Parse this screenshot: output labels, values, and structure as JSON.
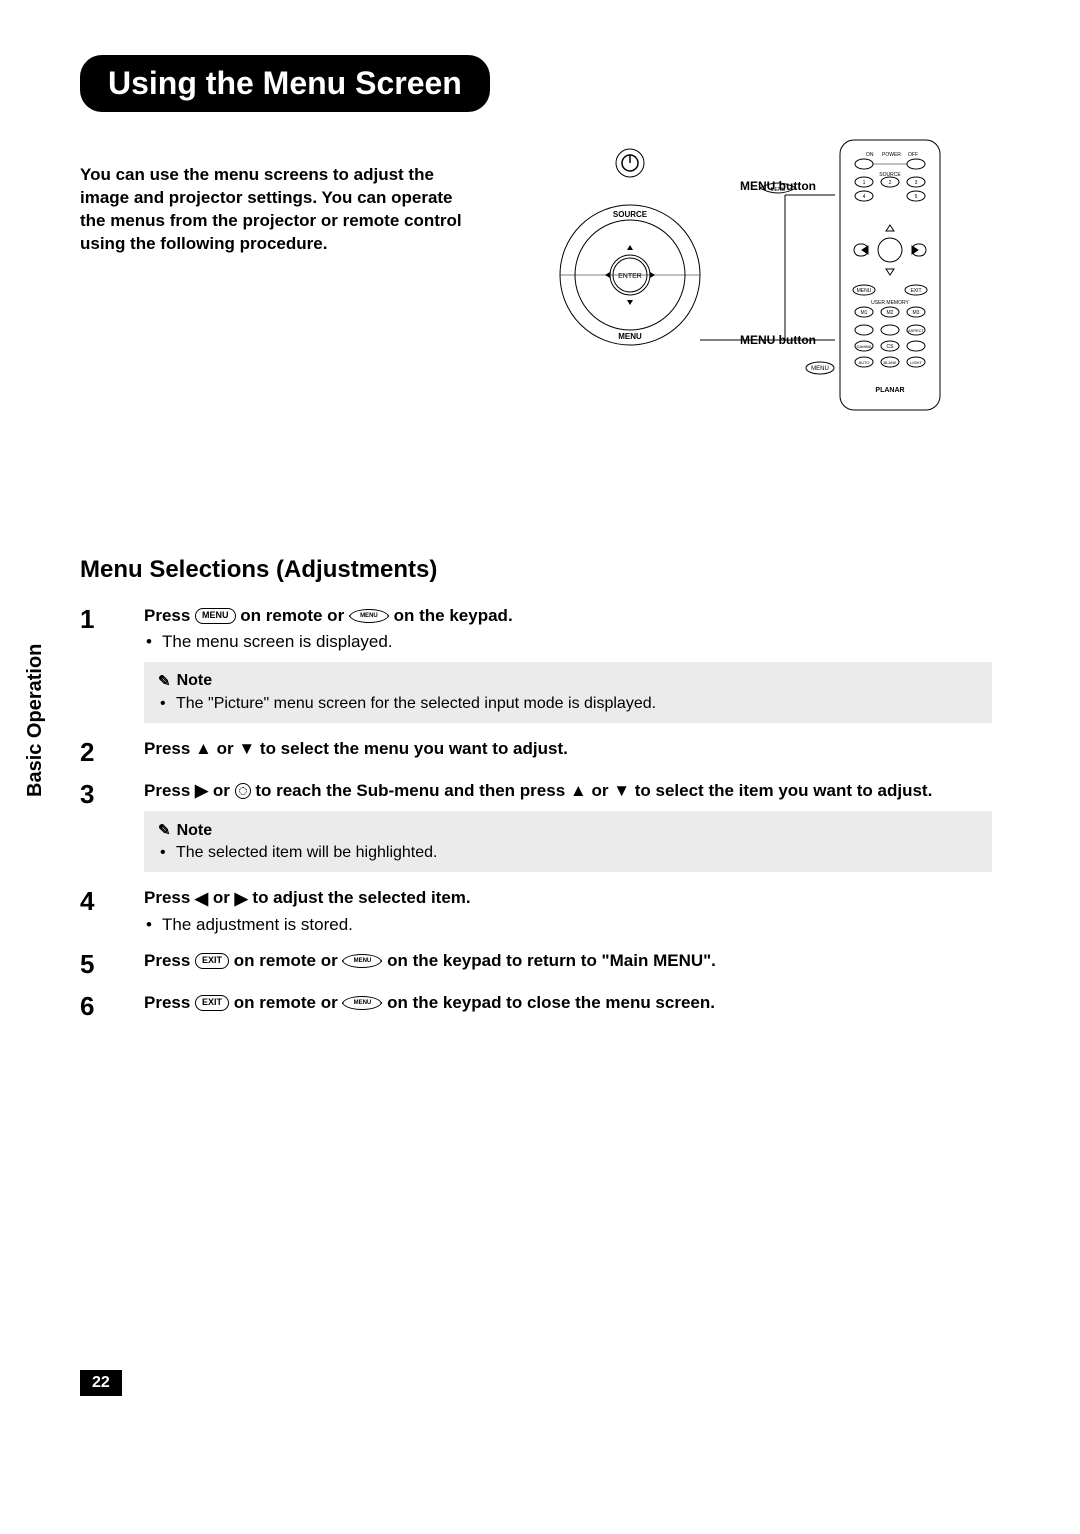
{
  "title": "Using the Menu Screen",
  "intro": "You can use the menu screens to adjust the image and projector settings. You can operate the menus from the projector or remote control using the following procedure.",
  "section_heading": "Menu Selections (Adjustments)",
  "sidebar": "Basic Operation",
  "page_number": "22",
  "diagram": {
    "menu_button_label_1": "MENU button",
    "menu_button_label_2": "MENU button",
    "keypad": {
      "source": "SOURCE",
      "enter": "ENTER",
      "menu": "MENU"
    },
    "remote": {
      "power_on": "ON",
      "power": "POWER",
      "power_off": "OFF",
      "source": "SOURCE",
      "user_memory": "USER MEMORY",
      "m1": "M1",
      "m2": "M2",
      "m3": "M3",
      "aspect": "ASPECT",
      "gamma": "GAMMA",
      "cs": "CS",
      "auto": "AUTO",
      "blank": "BLANK",
      "light": "LIGHT",
      "menu": "MENU",
      "exit": "EXIT",
      "brand": "PLANAR",
      "menu_small": "MENU"
    }
  },
  "buttons": {
    "menu": "MENU",
    "exit": "EXIT",
    "keypad_menu": "MENU"
  },
  "note_label": "Note",
  "steps": [
    {
      "num": "1",
      "head_parts": [
        "Press ",
        " on remote or ",
        " on the keypad."
      ],
      "bullet": "The menu screen is displayed.",
      "note": "The \"Picture\" menu screen for the selected input mode is displayed."
    },
    {
      "num": "2",
      "head_parts": [
        "Press ",
        " or ",
        " to select the menu you want to adjust."
      ]
    },
    {
      "num": "3",
      "head_parts": [
        "Press ",
        " or ",
        " to reach the Sub-menu and then press ",
        " or ",
        " to select the item you want to adjust."
      ],
      "note": "The selected item will be highlighted."
    },
    {
      "num": "4",
      "head_parts": [
        "Press ",
        " or ",
        " to adjust the selected item."
      ],
      "bullet": "The adjustment is stored."
    },
    {
      "num": "5",
      "head_parts": [
        "Press ",
        " on remote or ",
        " on the keypad to return to \"Main MENU\"."
      ]
    },
    {
      "num": "6",
      "head_parts": [
        "Press ",
        " on remote or ",
        " on the keypad to close the menu screen."
      ]
    }
  ]
}
